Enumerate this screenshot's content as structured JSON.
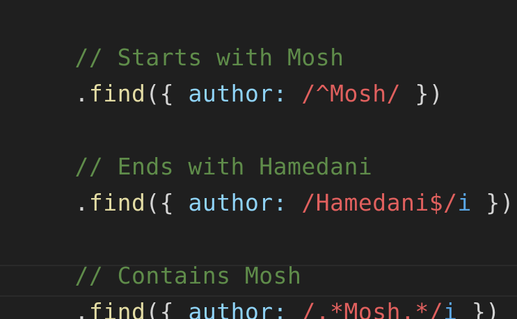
{
  "editor": {
    "lines": [
      {
        "comment": "// Starts with Mosh"
      },
      {
        "dot": ".",
        "method": "find",
        "open_paren": "(",
        "open_brace": "{ ",
        "key": "author:",
        "space": " ",
        "regex": "/^Mosh/",
        "flag": "",
        "close": " })"
      },
      {
        "comment": "// Ends with Hamedani"
      },
      {
        "dot": ".",
        "method": "find",
        "open_paren": "(",
        "open_brace": "{ ",
        "key": "author:",
        "space": " ",
        "regex": "/Hamedani$/",
        "flag": "i",
        "close": " })"
      },
      {
        "comment": "// Contains Mosh"
      },
      {
        "dot": ".",
        "method": "find",
        "open_paren": "(",
        "open_brace": "{ ",
        "key": "author:",
        "space": " ",
        "regex": "/.*Mosh.*/",
        "flag": "i",
        "close": " })"
      }
    ]
  },
  "colors": {
    "background": "#1f1f1f",
    "comment": "#5f8c4a",
    "method": "#e3dca4",
    "key": "#8fd3f7",
    "regex": "#e0605e",
    "flag": "#5aa7e6",
    "punctuation": "#d4d4d4"
  }
}
